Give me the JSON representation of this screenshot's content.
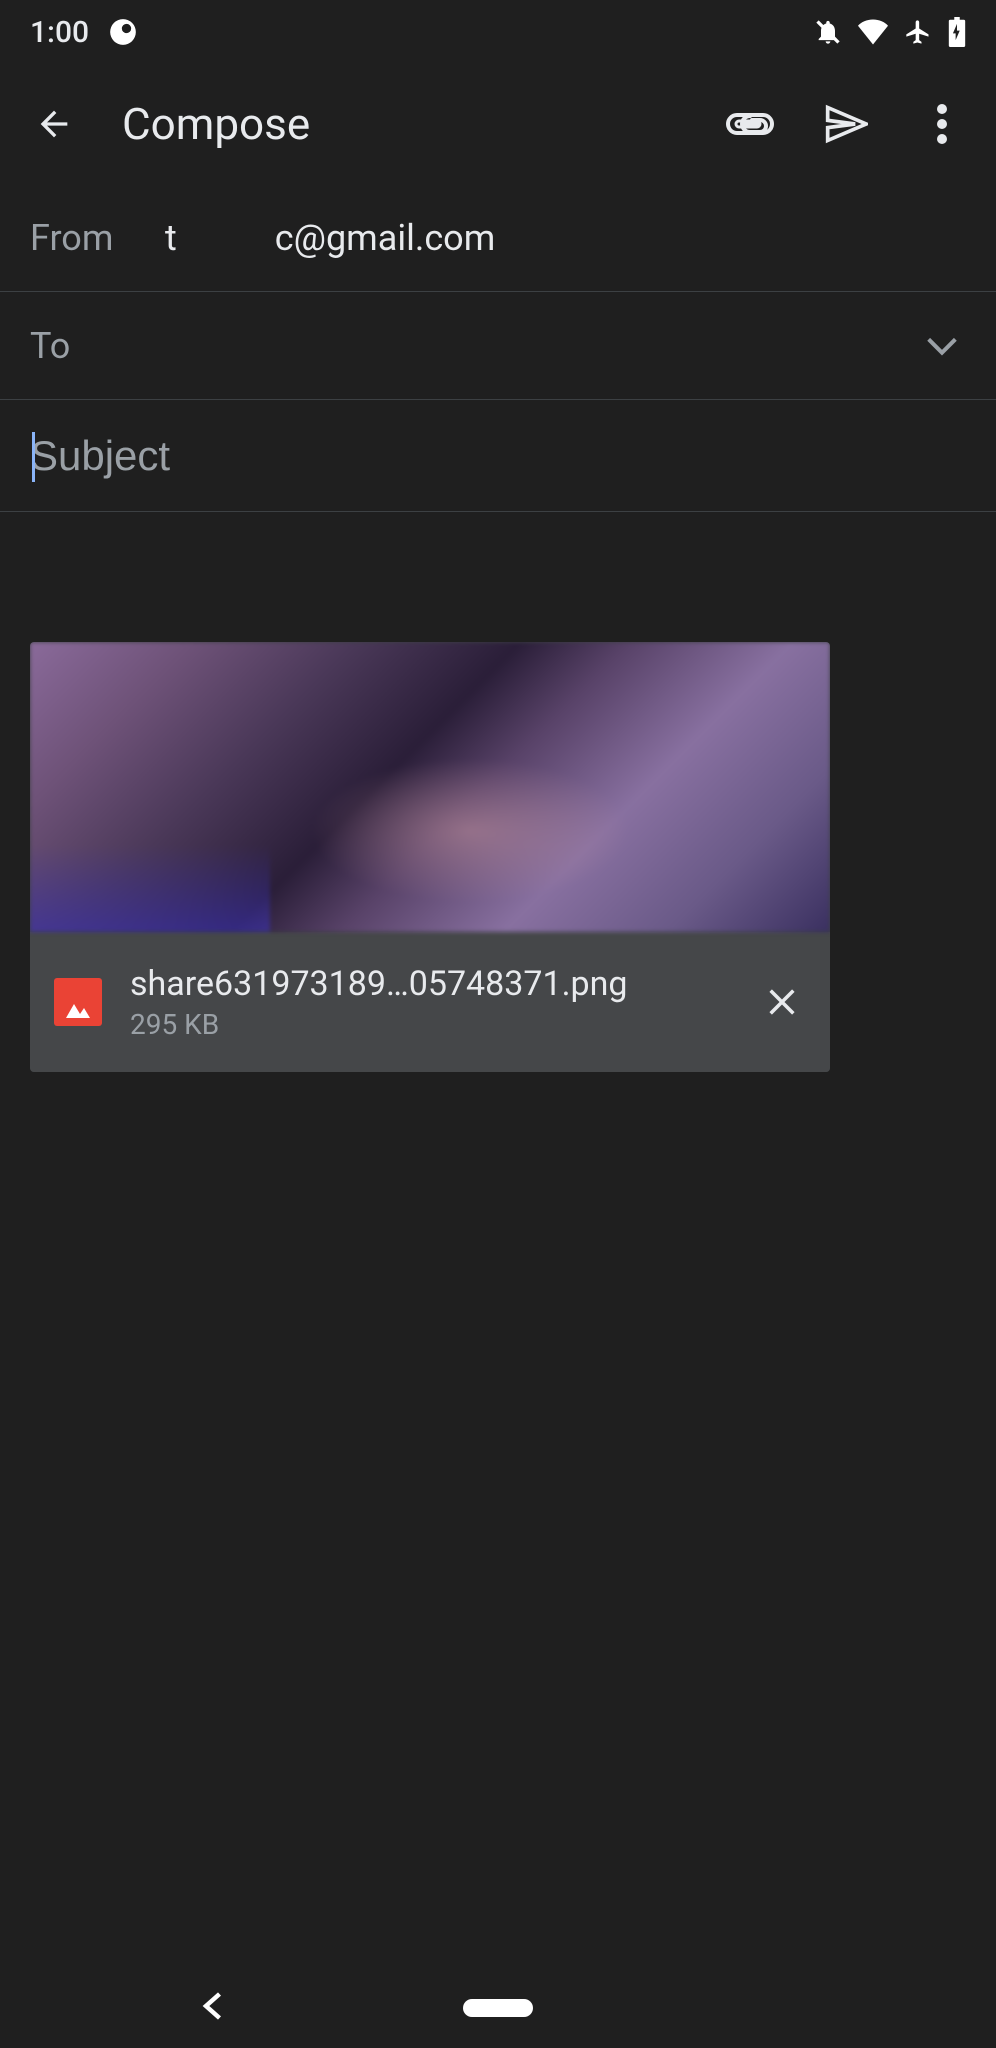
{
  "statusBar": {
    "time": "1:00"
  },
  "appBar": {
    "title": "Compose"
  },
  "from": {
    "label": "From",
    "emailPart1": "t",
    "emailPart2": "c@gmail.com"
  },
  "to": {
    "label": "To",
    "value": ""
  },
  "subject": {
    "placeholder": "Subject",
    "value": ""
  },
  "attachment": {
    "filename": "share631973189…05748371.png",
    "size": "295 KB"
  }
}
